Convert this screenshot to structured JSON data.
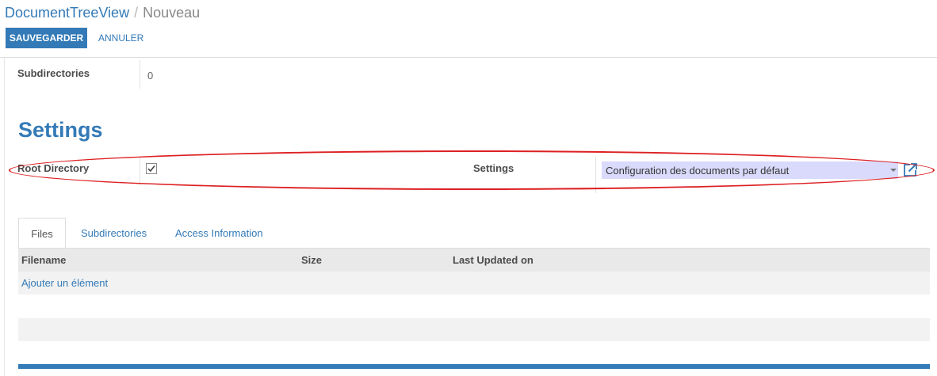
{
  "breadcrumb": {
    "parent": "DocumentTreeView",
    "separator": "/",
    "current": "Nouveau"
  },
  "toolbar": {
    "save_label": "SAUVEGARDER",
    "cancel_label": "ANNULER"
  },
  "fields": {
    "subdirectories": {
      "label": "Subdirectories",
      "value": "0"
    },
    "root_directory": {
      "label": "Root Directory",
      "checked": true
    },
    "settings": {
      "label": "Settings",
      "value": "Configuration des documents par défaut"
    }
  },
  "section": {
    "title": "Settings"
  },
  "tabs": [
    {
      "label": "Files",
      "active": true
    },
    {
      "label": "Subdirectories",
      "active": false
    },
    {
      "label": "Access Information",
      "active": false
    }
  ],
  "table": {
    "columns": [
      "Filename",
      "Size",
      "Last Updated on"
    ],
    "add_item_label": "Ajouter un élément"
  },
  "icons": {
    "checkbox_mark": "checkmark-icon",
    "dropdown": "caret-down-icon",
    "external": "external-link-icon"
  },
  "colors": {
    "primary": "#337ab7",
    "select_background": "#dadafc",
    "highlight": "#dd1f22"
  }
}
